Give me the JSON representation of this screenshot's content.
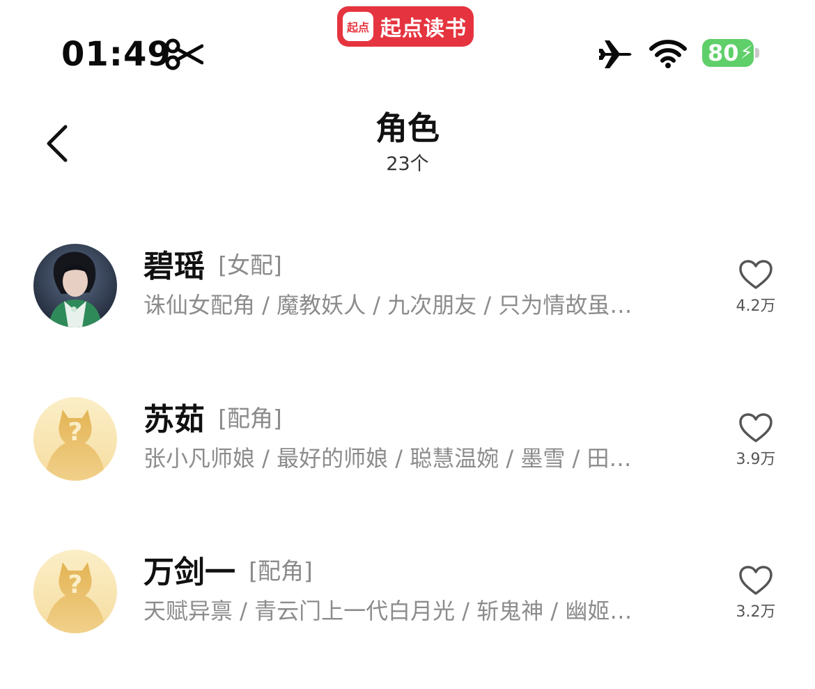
{
  "status_bar": {
    "time": "01:49",
    "app_logo_text": "起点",
    "app_name": "起点读书",
    "battery": "80",
    "battery_color": "#5fcf6a",
    "app_color": "#e5343f"
  },
  "header": {
    "title": "角色",
    "count": "23个"
  },
  "characters": [
    {
      "name": "碧瑶",
      "role": "[女配]",
      "tags": "诛仙女配角 / 魔教妖人 / 九次朋友 / 只为情故虽…",
      "likes": "4.2万",
      "avatar": "photo"
    },
    {
      "name": "苏茹",
      "role": "[配角]",
      "tags": "张小凡师娘 / 最好的师娘 / 聪慧温婉 / 墨雪 / 田…",
      "likes": "3.9万",
      "avatar": "placeholder"
    },
    {
      "name": "万剑一",
      "role": "[配角]",
      "tags": "天赋异禀 / 青云门上一代白月光 / 斩鬼神 / 幽姬…",
      "likes": "3.2万",
      "avatar": "placeholder"
    }
  ]
}
